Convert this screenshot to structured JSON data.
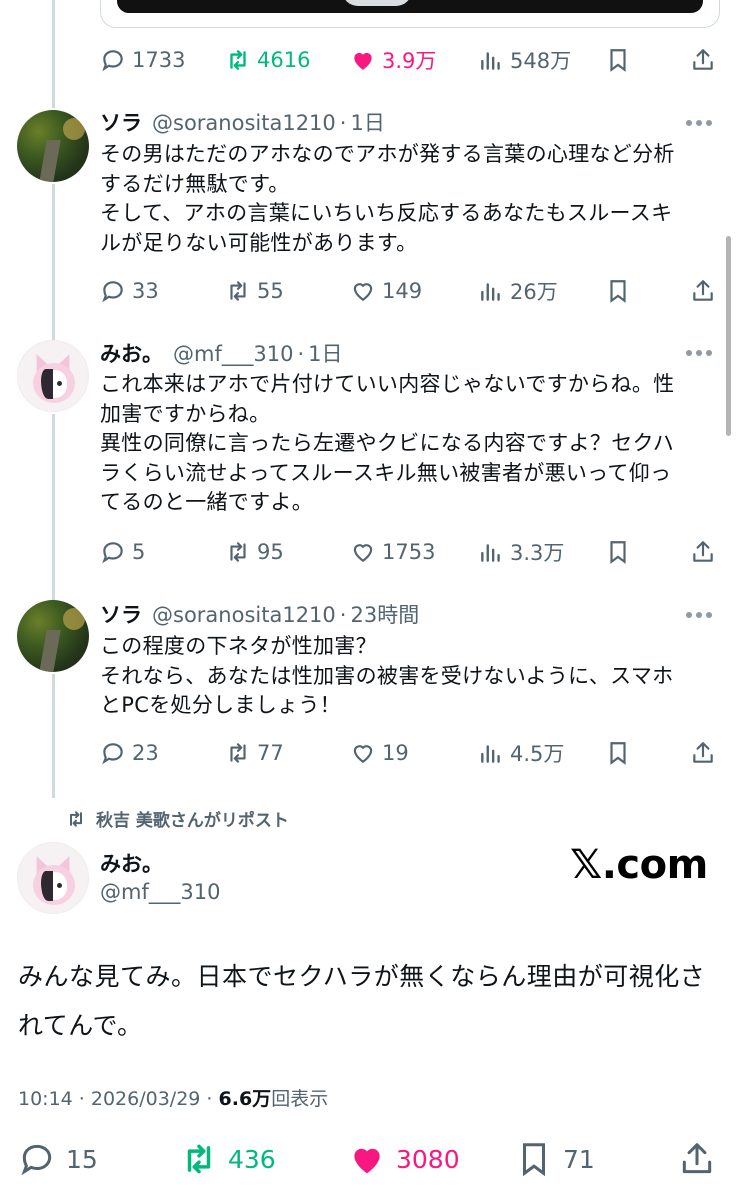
{
  "top_tweet_actions": {
    "replies": "1733",
    "reposts": "4616",
    "likes": "3.9万",
    "views": "548万"
  },
  "replies": [
    {
      "name": "ソラ",
      "handle": "@soranosita1210",
      "time": "1日",
      "lines": [
        "その男はただのアホなのでアホが発する言葉の心理など分析",
        "するだけ無駄です。",
        "そして、アホの言葉にいちいち反応するあなたもスルースキ",
        "ルが足りない可能性があります。"
      ],
      "replies": "33",
      "reposts": "55",
      "likes": "149",
      "views": "26万"
    },
    {
      "name": "みお。",
      "handle": "@mf___310",
      "time": "1日",
      "lines": [
        "これ本来はアホで片付けていい内容じゃないですからね。性",
        "加害ですからね。",
        "異性の同僚に言ったら左遷やクビになる内容ですよ？セクハ",
        "ラくらい流せよってスルースキル無い被害者が悪いって仰っ",
        "てるのと一緒ですよ。"
      ],
      "replies": "5",
      "reposts": "95",
      "likes": "1753",
      "views": "3.3万"
    },
    {
      "name": "ソラ",
      "handle": "@soranosita1210",
      "time": "23時間",
      "lines": [
        "この程度の下ネタが性加害？",
        "それなら、あなたは性加害の被害を受けないように、スマホ",
        "とPCを処分しましょう！"
      ],
      "replies": "23",
      "reposts": "77",
      "likes": "19",
      "views": "4.5万"
    }
  ],
  "repost_label": "秋吉 美歌さんがリポスト",
  "main_tweet": {
    "name": "みお。",
    "handle": "@mf___310",
    "watermark": "𝕏.com",
    "lines": [
      "みんな見てみ。日本でセクハラが無くならん理由が可視化さ",
      "れてんで。"
    ],
    "time": "10:14 · 2026/03/29 · ",
    "view_count": "6.6万",
    "view_label": "回表示",
    "replies": "15",
    "reposts": "436",
    "likes": "3080",
    "bookmarks": "71"
  },
  "colors": {
    "repost_active": "#00ba7c",
    "like_active": "#f91880",
    "secondary_text": "#536471"
  },
  "icons": [
    "reply-icon",
    "repost-icon",
    "like-icon",
    "views-icon",
    "bookmark-icon",
    "share-icon",
    "more-icon"
  ]
}
